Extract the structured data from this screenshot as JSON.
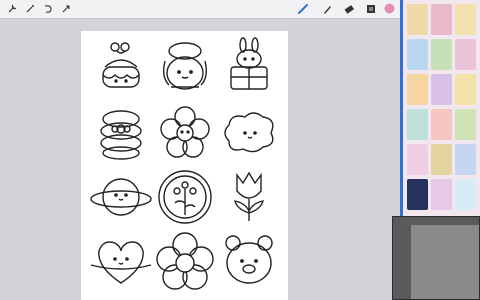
{
  "toolbar": {
    "left_tools": [
      "wrench-icon",
      "magic-wand-icon",
      "select-icon",
      "move-arrow-icon"
    ],
    "right_tools": [
      "pen-icon",
      "smudge-icon",
      "eraser-icon",
      "layers-icon",
      "color-swatch"
    ],
    "active_color": "#e58fb1",
    "accent": "#2f6fd6"
  },
  "canvas": {
    "stickers": [
      "cherry-cake",
      "bun-girl",
      "bunny-gift",
      "macaron-stack",
      "smiling-flower",
      "cloud-face",
      "planet-face",
      "round-flower",
      "tulip",
      "heart-face",
      "flower-face",
      "bear-face"
    ]
  },
  "sidebar": {
    "thumbnails": [
      {
        "color": "#f0d9a8"
      },
      {
        "color": "#e8b9c8"
      },
      {
        "color": "#f3e2b0"
      },
      {
        "color": "#b9d7ef"
      },
      {
        "color": "#c8e0b8"
      },
      {
        "color": "#e9c4d8"
      },
      {
        "color": "#f5d5a0"
      },
      {
        "color": "#d8c0e6"
      },
      {
        "color": "#f1e3a7"
      },
      {
        "color": "#bfe0d9"
      },
      {
        "color": "#f6c7c0"
      },
      {
        "color": "#cfe3b6"
      },
      {
        "color": "#efd0e2"
      },
      {
        "color": "#e3d39f"
      },
      {
        "color": "#c6d6f0"
      },
      {
        "color": "#26325e"
      },
      {
        "color": "#e5c9e6"
      },
      {
        "color": "#d8ecf6"
      }
    ]
  }
}
